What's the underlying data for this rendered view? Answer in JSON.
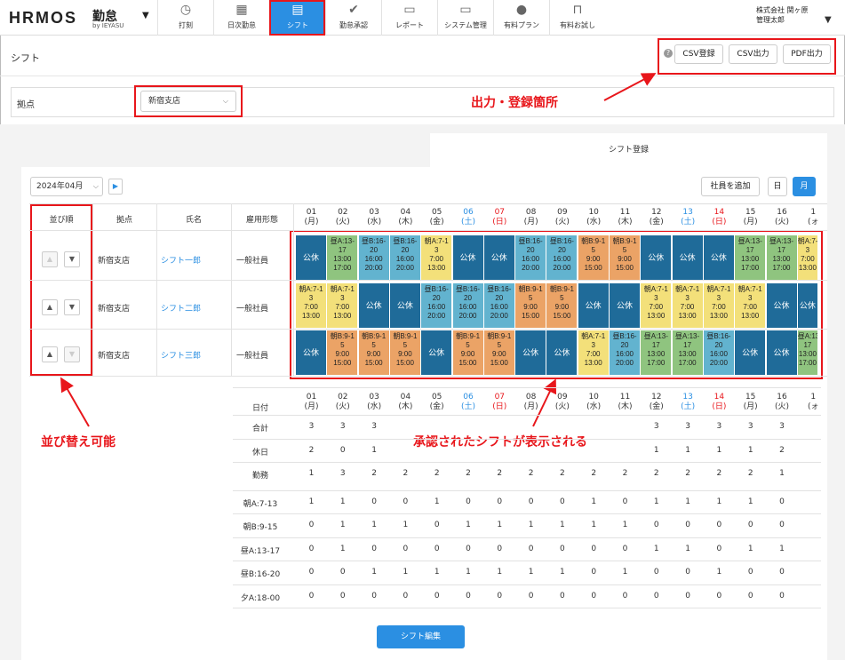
{
  "header": {
    "logo": "HRMOS",
    "logo_product": "勤怠",
    "logo_sub": "by IEYASU",
    "nav": [
      {
        "label": "打刻",
        "icon": "clock-icon",
        "glyph": "◷"
      },
      {
        "label": "日次勤怠",
        "icon": "calendar-icon",
        "glyph": "▦"
      },
      {
        "label": "シフト",
        "icon": "shift-icon",
        "glyph": "▤",
        "active": true
      },
      {
        "label": "勤怠承認",
        "icon": "check-icon",
        "glyph": "✔"
      },
      {
        "label": "レポート",
        "icon": "document-icon",
        "glyph": "▭"
      },
      {
        "label": "システム管理",
        "icon": "monitor-icon",
        "glyph": "▭"
      },
      {
        "label": "有料プラン",
        "icon": "person-icon",
        "glyph": "●"
      },
      {
        "label": "有料お試し",
        "icon": "lock-icon",
        "glyph": "⊓"
      }
    ],
    "user_company": "株式会社 関ヶ原",
    "user_name": "管理太郎"
  },
  "page": {
    "title": "シフト",
    "buttons": {
      "csv_register": "CSV登録",
      "csv_export": "CSV出力",
      "pdf_export": "PDF出力"
    },
    "location_label": "拠点",
    "location_value": "新宿支店",
    "tab_label": "シフト登録",
    "month_value": "2024年04月",
    "add_employee": "社員を追加",
    "view_day": "日",
    "view_month": "月",
    "edit_button": "シフト編集"
  },
  "annotations": {
    "output_register": "出力・登録箇所",
    "sortable": "並び替え可能",
    "approved_shifts": "承認されたシフトが表示される",
    "accent": "#e8161b"
  },
  "table": {
    "headers": {
      "order": "並び順",
      "location": "拠点",
      "name": "氏名",
      "employment": "雇用形態"
    },
    "days": [
      {
        "d": "01",
        "w": "(月)",
        "c": "n"
      },
      {
        "d": "02",
        "w": "(火)",
        "c": "n"
      },
      {
        "d": "03",
        "w": "(水)",
        "c": "n"
      },
      {
        "d": "04",
        "w": "(木)",
        "c": "n"
      },
      {
        "d": "05",
        "w": "(金)",
        "c": "n"
      },
      {
        "d": "06",
        "w": "(土)",
        "c": "sat"
      },
      {
        "d": "07",
        "w": "(日)",
        "c": "sun"
      },
      {
        "d": "08",
        "w": "(月)",
        "c": "n"
      },
      {
        "d": "09",
        "w": "(火)",
        "c": "n"
      },
      {
        "d": "10",
        "w": "(水)",
        "c": "n"
      },
      {
        "d": "11",
        "w": "(木)",
        "c": "n"
      },
      {
        "d": "12",
        "w": "(金)",
        "c": "n"
      },
      {
        "d": "13",
        "w": "(土)",
        "c": "sat"
      },
      {
        "d": "14",
        "w": "(日)",
        "c": "sun"
      },
      {
        "d": "15",
        "w": "(月)",
        "c": "n"
      },
      {
        "d": "16",
        "w": "(火)",
        "c": "n"
      },
      {
        "d": "1",
        "w": "(ォ",
        "c": "n"
      }
    ],
    "employees": [
      {
        "location": "新宿支店",
        "name": "シフト一郎",
        "employment": "一般社員",
        "up_disabled": true,
        "down_disabled": false,
        "shifts": [
          "off",
          "h13",
          "h16",
          "h16",
          "a7",
          "off",
          "off",
          "h16",
          "h16",
          "b9",
          "b9",
          "off",
          "off",
          "off",
          "h13",
          "h13",
          "a7"
        ]
      },
      {
        "location": "新宿支店",
        "name": "シフト二郎",
        "employment": "一般社員",
        "up_disabled": false,
        "down_disabled": false,
        "shifts": [
          "a7",
          "a7",
          "off",
          "off",
          "h16",
          "h16",
          "h16",
          "b9",
          "b9",
          "off",
          "off",
          "a7",
          "a7",
          "a7",
          "a7",
          "off",
          "off"
        ]
      },
      {
        "location": "新宿支店",
        "name": "シフト三郎",
        "employment": "一般社員",
        "up_disabled": false,
        "down_disabled": true,
        "shifts": [
          "off",
          "b9",
          "b9",
          "b9",
          "off",
          "b9",
          "b9",
          "off",
          "off",
          "a7",
          "h16",
          "h13",
          "h13",
          "h16",
          "off",
          "off",
          "h13"
        ]
      }
    ],
    "shift_types": {
      "off": {
        "text": "公休",
        "color": "#1f6b99"
      },
      "a7": {
        "text": "朝A:7-1\n3\n7:00\n13:00",
        "color": "#f3e07a"
      },
      "b9": {
        "text": "朝B:9-1\n5\n9:00\n15:00",
        "color": "#eba366"
      },
      "h13": {
        "text": "昼A:13-\n17\n13:00\n17:00",
        "color": "#8fc47f"
      },
      "h16": {
        "text": "昼B:16-\n20\n16:00\n20:00",
        "color": "#62b3cf"
      }
    },
    "day_colors": {
      "sat": "#2b8fe2",
      "sun": "#e8161b"
    }
  },
  "summary": {
    "date_label": "日付",
    "rows": [
      {
        "label": "合計",
        "values": [
          "3",
          "3",
          "3",
          "",
          "",
          "",
          "",
          "",
          "",
          "",
          "",
          "3",
          "3",
          "3",
          "3",
          "3",
          ""
        ]
      },
      {
        "label": "休日",
        "values": [
          "2",
          "0",
          "1",
          "",
          "",
          "",
          "",
          "",
          "",
          "",
          "",
          "1",
          "1",
          "1",
          "1",
          "2",
          ""
        ]
      },
      {
        "label": "勤務",
        "values": [
          "1",
          "3",
          "2",
          "2",
          "2",
          "2",
          "2",
          "2",
          "2",
          "2",
          "2",
          "2",
          "2",
          "2",
          "2",
          "1",
          ""
        ]
      },
      {
        "label": "朝A:7-13",
        "values": [
          "1",
          "1",
          "0",
          "0",
          "1",
          "0",
          "0",
          "0",
          "0",
          "1",
          "0",
          "1",
          "1",
          "1",
          "1",
          "0",
          ""
        ]
      },
      {
        "label": "朝B:9-15",
        "values": [
          "0",
          "1",
          "1",
          "1",
          "0",
          "1",
          "1",
          "1",
          "1",
          "1",
          "1",
          "0",
          "0",
          "0",
          "0",
          "0",
          ""
        ]
      },
      {
        "label": "昼A:13-17",
        "values": [
          "0",
          "1",
          "0",
          "0",
          "0",
          "0",
          "0",
          "0",
          "0",
          "0",
          "0",
          "1",
          "1",
          "0",
          "1",
          "1",
          ""
        ]
      },
      {
        "label": "昼B:16-20",
        "values": [
          "0",
          "0",
          "1",
          "1",
          "1",
          "1",
          "1",
          "1",
          "1",
          "0",
          "1",
          "0",
          "0",
          "1",
          "0",
          "0",
          ""
        ]
      },
      {
        "label": "夕A:18-00",
        "values": [
          "0",
          "0",
          "0",
          "0",
          "0",
          "0",
          "0",
          "0",
          "0",
          "0",
          "0",
          "0",
          "0",
          "0",
          "0",
          "0",
          ""
        ]
      }
    ]
  }
}
